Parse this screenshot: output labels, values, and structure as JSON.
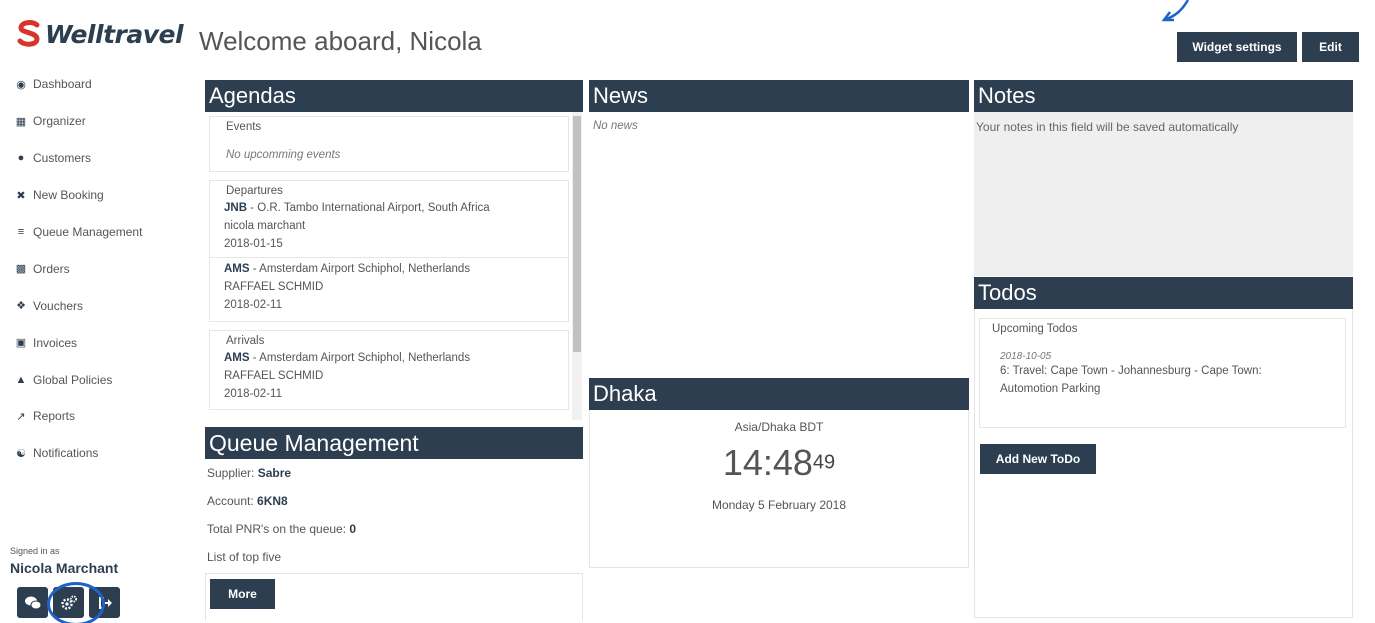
{
  "brand": {
    "name": "Welltravel"
  },
  "header": {
    "title": "Welcome aboard, Nicola",
    "widget_settings": "Widget settings",
    "edit": "Edit"
  },
  "sidebar": {
    "items": [
      {
        "label": "Dashboard",
        "icon": "dashboard-icon"
      },
      {
        "label": "Organizer",
        "icon": "calendar-icon"
      },
      {
        "label": "Customers",
        "icon": "users-icon"
      },
      {
        "label": "New Booking",
        "icon": "plane-icon"
      },
      {
        "label": "Queue Management",
        "icon": "bars-icon"
      },
      {
        "label": "Orders",
        "icon": "briefcase-icon"
      },
      {
        "label": "Vouchers",
        "icon": "tag-icon"
      },
      {
        "label": "Invoices",
        "icon": "money-icon"
      },
      {
        "label": "Global Policies",
        "icon": "sitemap-icon"
      },
      {
        "label": "Reports",
        "icon": "chart-icon"
      },
      {
        "label": "Notifications",
        "icon": "bell-icon"
      }
    ],
    "signed_in_label": "Signed in as",
    "user_name": "Nicola Marchant"
  },
  "agendas": {
    "title": "Agendas",
    "events_label": "Events",
    "events_empty": "No upcomming events",
    "departures_label": "Departures",
    "departures": [
      {
        "code": "JNB",
        "place": " - O.R. Tambo International Airport, South Africa",
        "name": "nicola marchant",
        "date": "2018-01-15"
      },
      {
        "code": "AMS",
        "place": " - Amsterdam Airport Schiphol, Netherlands",
        "name": "RAFFAEL SCHMID",
        "date": "2018-02-11"
      }
    ],
    "arrivals_label": "Arrivals",
    "arrivals": [
      {
        "code": "AMS",
        "place": " - Amsterdam Airport Schiphol, Netherlands",
        "name": "RAFFAEL SCHMID",
        "date": "2018-02-11"
      }
    ]
  },
  "queue": {
    "title": "Queue Management",
    "supplier_label": "Supplier: ",
    "supplier": "Sabre",
    "account_label": "Account: ",
    "account": "6KN8",
    "total_label": "Total PNR's on the queue: ",
    "total": "0",
    "top_five": "List of top five",
    "more": "More"
  },
  "news": {
    "title": "News",
    "empty": "No news"
  },
  "clock": {
    "title": "Dhaka",
    "timezone": "Asia/Dhaka BDT",
    "time": "14:48",
    "seconds": "49",
    "date": "Monday 5 February 2018"
  },
  "notes": {
    "title": "Notes",
    "placeholder": "Your notes in this field will be saved automatically"
  },
  "todos": {
    "title": "Todos",
    "upcoming_label": "Upcoming Todos",
    "items": [
      {
        "date": "2018-10-05",
        "text": "6: Travel: Cape Town - Johannesburg - Cape Town: Automotion Parking"
      }
    ],
    "add_button": "Add New ToDo"
  },
  "colors": {
    "primary": "#2d3e50",
    "logo_red": "#d9342b",
    "highlight": "#1e63c8"
  }
}
